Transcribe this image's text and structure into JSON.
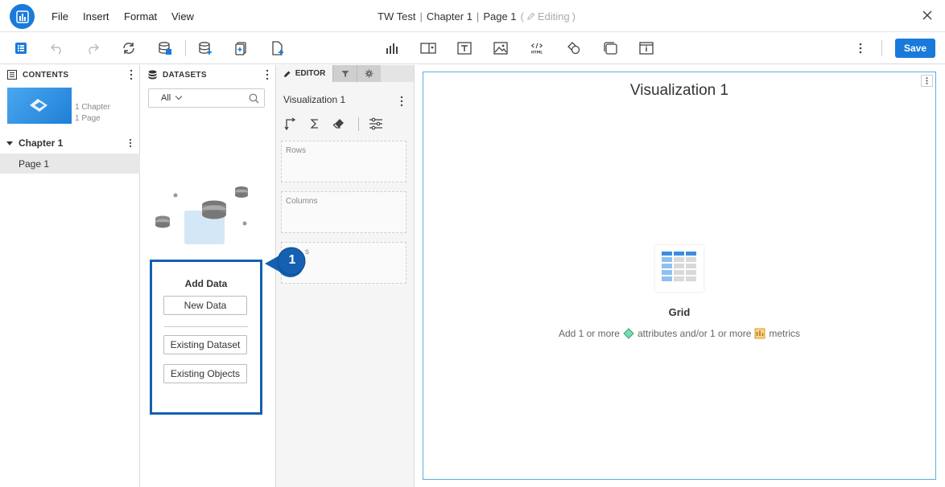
{
  "menu": {
    "file": "File",
    "insert": "Insert",
    "format": "Format",
    "view": "View"
  },
  "title": {
    "doc": "TW Test",
    "separator": "|",
    "chapter": "Chapter 1",
    "page": "Page 1",
    "status_open": "(",
    "status": "Editing",
    "status_close": ")"
  },
  "toolbar": {
    "save_label": "Save"
  },
  "contents": {
    "header": "CONTENTS",
    "thumb_chapters": "1 Chapter",
    "thumb_pages": "1 Page",
    "chapter": "Chapter 1",
    "page": "Page 1"
  },
  "datasets": {
    "header": "DATASETS",
    "filter_value": "All",
    "add_data_title": "Add Data",
    "new_data": "New Data",
    "existing_dataset": "Existing Dataset",
    "existing_objects": "Existing Objects"
  },
  "callout": {
    "number": "1"
  },
  "editor": {
    "tab_label": "EDITOR",
    "viz_name": "Visualization 1",
    "rows_label": "Rows",
    "columns_label": "Columns",
    "metrics_label": "s"
  },
  "canvas": {
    "viz_title": "Visualization 1",
    "grid_label": "Grid",
    "hint_prefix": "Add 1 or more",
    "hint_attributes": "attributes and/or 1 or more",
    "hint_metrics": "metrics"
  },
  "colors": {
    "accent": "#1a7adb",
    "callout": "#1560b0",
    "viz_border": "#5aaed8",
    "attribute": "#3dbf8c",
    "metric": "#e3a83b"
  }
}
